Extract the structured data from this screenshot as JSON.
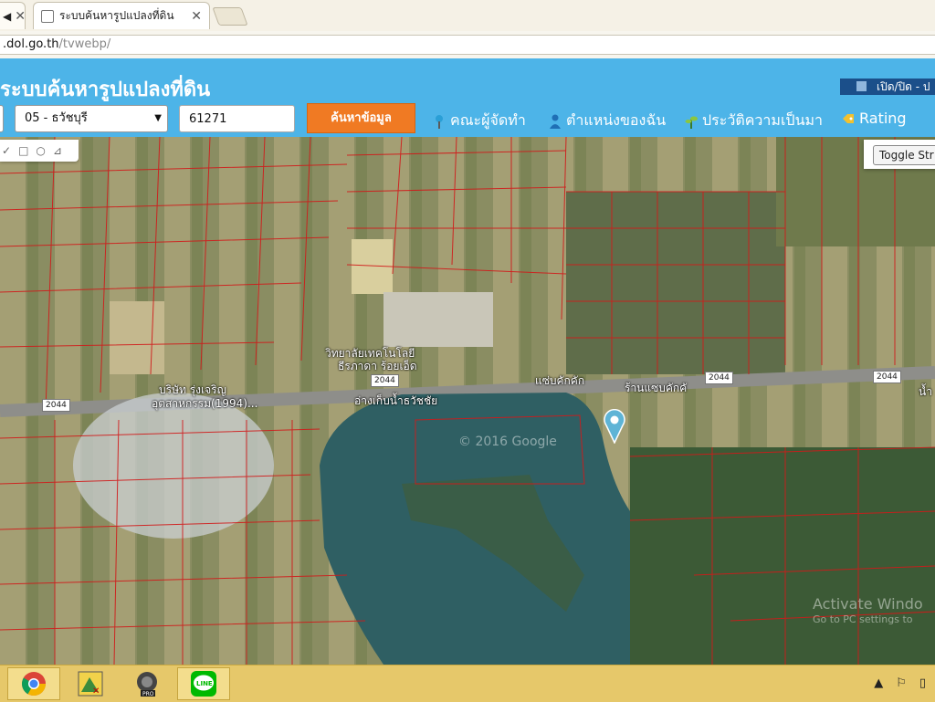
{
  "browser": {
    "left_tab": {
      "icon": "speaker-icon",
      "close": "✕"
    },
    "active_tab": {
      "title": "ระบบค้นหารูปแปลงที่ดิน",
      "close": "✕"
    },
    "url": {
      "host": ".dol.go.th",
      "path": "/tvwebp/"
    }
  },
  "app": {
    "title": "ระบบค้นหารูปแปลงที่ดิน",
    "toggle_label": "เปิด/ปิด - ป",
    "province_select": {
      "value": "05 - ธวัชบุรี",
      "arrow": "▼"
    },
    "parcel_input": {
      "value": "61271"
    },
    "search_button": "ค้นหาข้อมูล",
    "nav": [
      {
        "label": "คณะผู้จัดทำ",
        "icon": "pin-icon"
      },
      {
        "label": "ตำแหน่งของฉัน",
        "icon": "person-icon"
      },
      {
        "label": "ประวัติความเป็นมา",
        "icon": "leaf-icon"
      },
      {
        "label": "Rating",
        "icon": "tag-icon"
      }
    ]
  },
  "map": {
    "draw_tools": [
      "✓",
      "□",
      "○",
      "⊿"
    ],
    "toggle_street_label": "Toggle Str",
    "labels": {
      "college_line1": "วิทยาลัยเทคโนโลยี",
      "college_line2": "ธีรภาดา ร้อยเอ็ด",
      "company_line1": "บริษัท รุ่งเจริญ",
      "company_line2": "อุตสาหกรรม(1994)...",
      "reservoir": "อ่างเก็บน้ำธวัชชัย",
      "restaurant1": "แซ่บคักคัก",
      "restaurant2": "ร้านแซบคักคั",
      "edge_label": "น้ำ"
    },
    "road_shields": [
      "2044",
      "2044",
      "2044",
      "2044"
    ],
    "watermark": "© 2016 Google",
    "activate": "Activate Windo",
    "activate_sub": "Go to PC settings to"
  },
  "taskbar": {
    "items": [
      "chrome-icon",
      "image-viewer-icon",
      "media-pro-icon",
      "line-icon"
    ],
    "tray": [
      "▲",
      "⚐",
      "▯"
    ]
  },
  "colors": {
    "header_blue": "#4db4e8",
    "search_orange": "#f07a23",
    "parcel_line": "#d11a1a",
    "taskbar": "#e6c86a"
  }
}
